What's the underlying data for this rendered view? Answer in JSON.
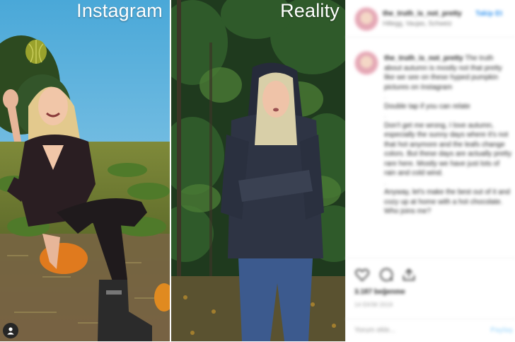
{
  "photos": {
    "left_caption": "Instagram",
    "right_caption": "Reality"
  },
  "post": {
    "username": "the_truth_is_not_pretty",
    "follow_label": "Takip Et",
    "location": "Hillegg, Vaujas, Schweiz",
    "caption_paragraphs": [
      "The truth about autumn is mostly not that pretty like we see on these hyped pumpkin pictures on Instagram",
      "Double tap if you can relate",
      "Don't get me wrong, I love autumn, especially the sunny days where it's not that hot anymore and the leafs change colors. But these days are actually pretty rare here. Mostly we have just lots of rain and cold wind.",
      "Anyway, let's make the best out of it and cozy up at home with a hot chocolate. Who joins me?"
    ],
    "likes": "3.187 beğenme",
    "time": "14 EKİM 2019",
    "comment_placeholder": "Yorum ekle...",
    "post_label": "Paylaş"
  },
  "colors": {
    "link_blue": "#3897f0",
    "text_dark": "#262626",
    "muted": "#999999"
  }
}
